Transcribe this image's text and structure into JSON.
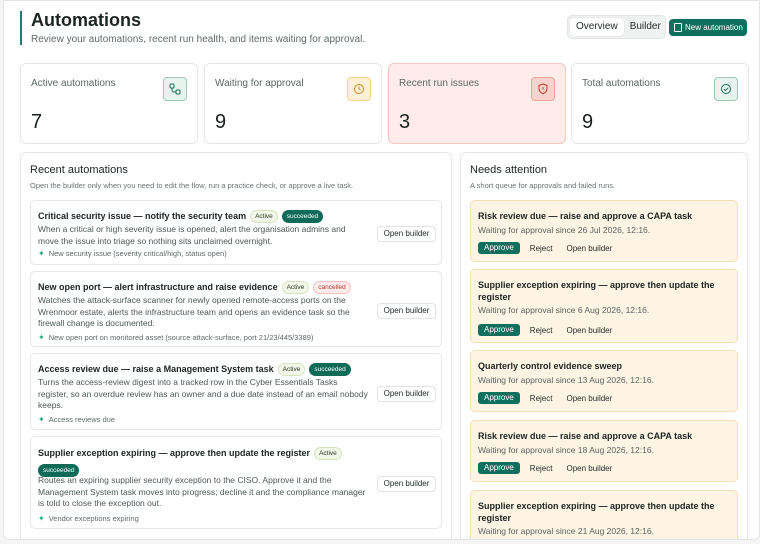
{
  "header": {
    "title": "Automations",
    "subtitle": "Review your automations, recent run health, and items waiting for approval."
  },
  "tabs": {
    "overview": "Overview",
    "builder": "Builder"
  },
  "new_button": "New automation",
  "stats": [
    {
      "label": "Active automations",
      "value": "7",
      "icon": "workflow-icon"
    },
    {
      "label": "Waiting for approval",
      "value": "9",
      "icon": "clock-icon"
    },
    {
      "label": "Recent run issues",
      "value": "3",
      "icon": "shield-alert-icon"
    },
    {
      "label": "Total automations",
      "value": "9",
      "icon": "check-circle-icon"
    }
  ],
  "recent": {
    "title": "Recent automations",
    "subtitle": "Open the builder only when you need to edit the flow, run a practice check, or approve a live task.",
    "open_label": "Open builder",
    "items": [
      {
        "title": "Critical security issue — notify the security team",
        "status": "Active",
        "run": "succeeded",
        "desc": "When a critical or high severity issue is opened, alert the organisation admins and move the issue into triage so nothing sits unclaimed overnight.",
        "trigger": "New security issue (severity critical/high, status open)"
      },
      {
        "title": "New open port — alert infrastructure and raise evidence",
        "status": "Active",
        "run": "cancelled",
        "desc": "Watches the attack-surface scanner for newly opened remote-access ports on the Wrenmoor estate, alerts the infrastructure team and opens an evidence task so the firewall change is documented.",
        "trigger": "New open port on monitored asset (source attack-surface, port 21/23/445/3389)"
      },
      {
        "title": "Access review due — raise a Management System task",
        "status": "Active",
        "run": "succeeded",
        "desc": "Turns the access-review digest into a tracked row in the Cyber Essentials Tasks register, so an overdue review has an owner and a due date instead of an email nobody keeps.",
        "trigger": "Access reviews due"
      },
      {
        "title": "Supplier exception expiring — approve then update the register",
        "status": "Active",
        "run": "succeeded",
        "desc": "Routes an expiring supplier security exception to the CISO. Approve it and the Management System task moves into progress; decline it and the compliance manager is told to close the exception out.",
        "trigger": "Vendor exceptions expiring"
      }
    ]
  },
  "attention": {
    "title": "Needs attention",
    "subtitle": "A short queue for approvals and failed runs.",
    "approve": "Approve",
    "reject": "Reject",
    "open": "Open builder",
    "items": [
      {
        "title": "Risk review due — raise and approve a CAPA task",
        "meta": "Waiting for approval since 26 Jul 2026, 12:16."
      },
      {
        "title": "Supplier exception expiring — approve then update the register",
        "meta": "Waiting for approval since 6 Aug 2026, 12:16."
      },
      {
        "title": "Quarterly control evidence sweep",
        "meta": "Waiting for approval since 13 Aug 2026, 12:16."
      },
      {
        "title": "Risk review due — raise and approve a CAPA task",
        "meta": "Waiting for approval since 18 Aug 2026, 12:16."
      },
      {
        "title": "Supplier exception expiring — approve then update the register",
        "meta": "Waiting for approval since 21 Aug 2026, 12:16."
      }
    ]
  },
  "colors": {
    "accent": "#11705d",
    "warn_bg": "#fdecea",
    "attention_bg": "#fdf4e3"
  }
}
